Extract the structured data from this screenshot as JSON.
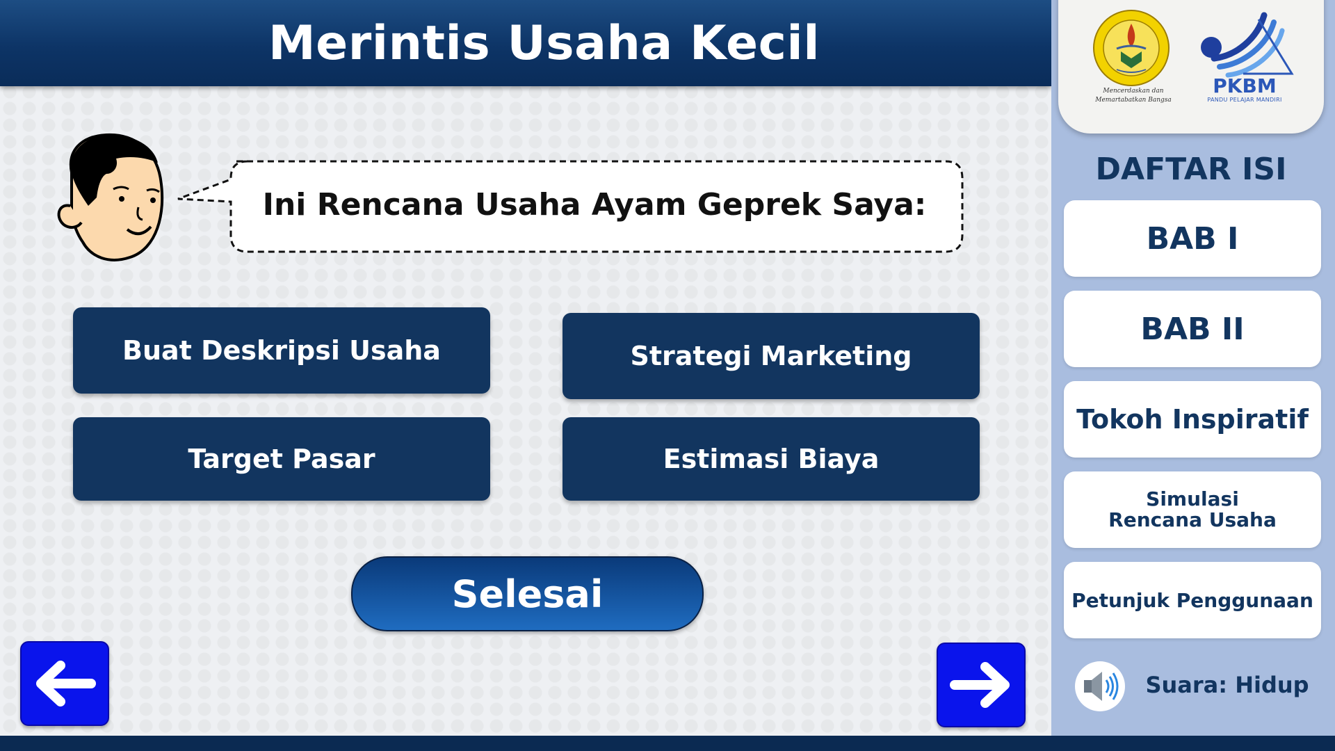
{
  "header": {
    "title": "Merintis Usaha Kecil"
  },
  "logos": {
    "unj_motto_line1": "Mencerdaskan dan",
    "unj_motto_line2": "Memartabatkan Bangsa",
    "pkbm_name": "PKBM",
    "pkbm_subtitle": "PANDU PELAJAR MANDIRI"
  },
  "sidebar": {
    "title": "DAFTAR ISI",
    "items": [
      {
        "label": "BAB I"
      },
      {
        "label": "BAB II"
      },
      {
        "label": "Tokoh Inspiratif"
      },
      {
        "label": "Simulasi Rencana Usaha"
      },
      {
        "label": "Petunjuk Penggunaan"
      }
    ],
    "sound_label": "Suara: Hidup"
  },
  "speech": {
    "text": "Ini Rencana Usaha Ayam Geprek Saya:"
  },
  "actions": [
    {
      "label": "Buat Deskripsi Usaha"
    },
    {
      "label": "Strategi Marketing"
    },
    {
      "label": "Target Pasar"
    },
    {
      "label": "Estimasi Biaya"
    }
  ],
  "finish_label": "Selesai",
  "nav": {
    "prev_icon": "arrow-left-icon",
    "next_icon": "arrow-right-icon"
  },
  "colors": {
    "navy": "#12355f",
    "sidebar": "#a9bddf",
    "nav_blue": "#0a14ec"
  }
}
